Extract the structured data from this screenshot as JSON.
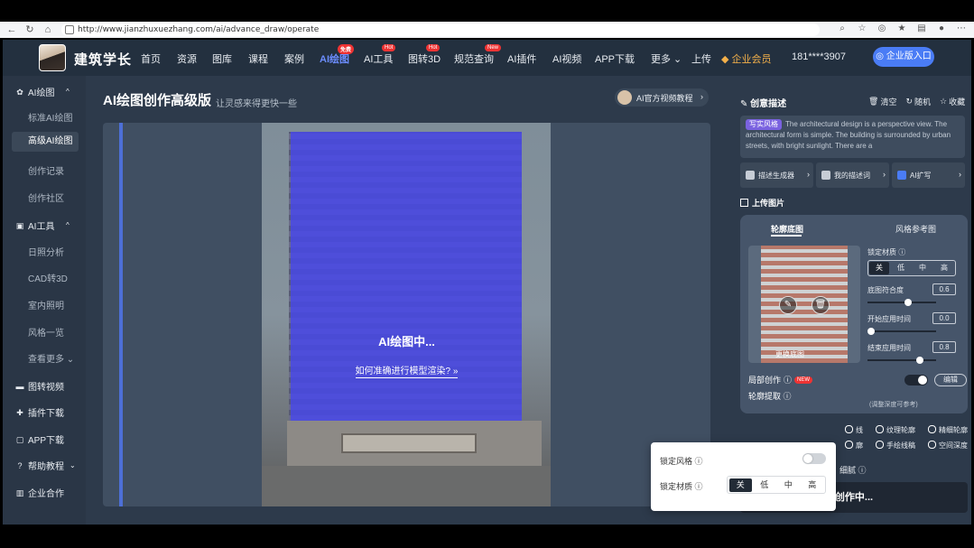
{
  "browser": {
    "url": "http://www.jianzhuxuezhang.com/ai/advance_draw/operate"
  },
  "nav": {
    "brand": "建筑学长",
    "items": [
      {
        "label": "首页",
        "badge": ""
      },
      {
        "label": "资源",
        "badge": ""
      },
      {
        "label": "图库",
        "badge": ""
      },
      {
        "label": "课程",
        "badge": ""
      },
      {
        "label": "案例",
        "badge": ""
      },
      {
        "label": "AI绘图",
        "badge": "免费"
      },
      {
        "label": "AI工具",
        "badge": "Hot"
      },
      {
        "label": "图转3D",
        "badge": "Hot"
      },
      {
        "label": "规范查询",
        "badge": "New"
      },
      {
        "label": "AI插件",
        "badge": ""
      },
      {
        "label": "AI视频",
        "badge": ""
      },
      {
        "label": "APP下载",
        "badge": ""
      },
      {
        "label": "更多",
        "badge": ""
      },
      {
        "label": "上传",
        "badge": ""
      }
    ],
    "vip": "企业会员",
    "phone": "181****3907",
    "enterprise_btn": "企业版入口",
    "accent": "#6c8dff"
  },
  "sidebar": {
    "group_ai_draw": "AI绘图",
    "ai_draw_items": [
      "标准AI绘图",
      "高级AI绘图",
      "创作记录",
      "创作社区"
    ],
    "group_ai_tools": "AI工具",
    "ai_tool_items": [
      "日照分析",
      "CAD转3D",
      "室内照明",
      "风格一览",
      "查看更多"
    ],
    "bottom_items": [
      "图转视频",
      "插件下载",
      "APP下载",
      "帮助教程",
      "企业合作"
    ]
  },
  "main": {
    "title": "AI绘图创作高级版",
    "subtitle": "让灵感来得更快一些",
    "tutorial": "AI官方视频教程",
    "overlay_title": "AI绘图中...",
    "overlay_link": "如何准确进行模型渲染?  »"
  },
  "right": {
    "prompt_head": "创意描述",
    "actions": [
      "清空",
      "随机",
      "收藏"
    ],
    "prompt_tag": "写实风格",
    "prompt_text": "The architectural design is a perspective view. The architectural form is simple. The building is surrounded by urban streets, with bright sunlight. There are a",
    "tools": [
      "描述生成器",
      "我的描述词",
      "AI扩写"
    ],
    "upload_head": "上传图片",
    "tabs": [
      "轮廓底图",
      "风格参考图"
    ],
    "thumb_caption": "更换底图",
    "lock_material": "锁定材质",
    "seg_options": [
      "关",
      "低",
      "中",
      "高"
    ],
    "base_fit": "底图符合度",
    "base_fit_value": "0.6",
    "start_time": "开始应用时间",
    "start_time_value": "0.0",
    "end_time": "结束应用时间",
    "end_time_value": "0.8",
    "local_create": "局部创作",
    "new_badge": "NEW",
    "edit": "编辑",
    "contour": "轮廓提取",
    "contour_hint": "(调整深度可参考)",
    "radios_row1": [
      "线",
      "纹理轮廓",
      "精细轮廓"
    ],
    "radios_row2": [
      "廓",
      "手绘线稿",
      "空间深度"
    ],
    "create_btn": "创作中...",
    "fine": "细腻"
  },
  "popover": {
    "lock_style": "锁定风格",
    "lock_material": "锁定材质",
    "options": [
      "关",
      "低",
      "中",
      "高"
    ],
    "selected": "关"
  }
}
